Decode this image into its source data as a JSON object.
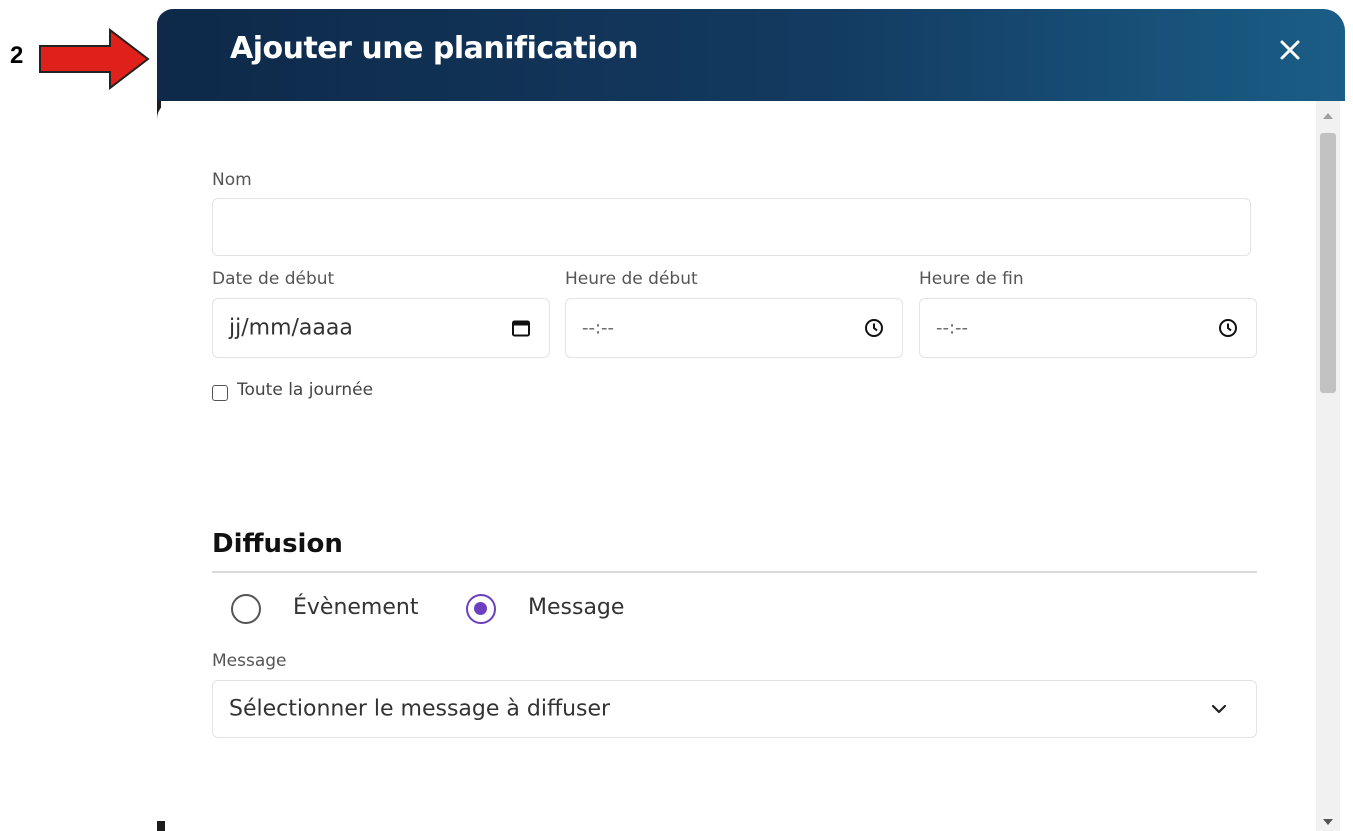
{
  "annotation": {
    "step_number": "2",
    "arrow_color": "#e0211b"
  },
  "dialog": {
    "title": "Ajouter une planification",
    "close_icon": "close-icon",
    "header_colors": [
      "#0e2949",
      "#1a5d86"
    ]
  },
  "form": {
    "name": {
      "label": "Nom",
      "value": ""
    },
    "start_date": {
      "label": "Date de début",
      "placeholder": "jj/mm/aaaa",
      "icon": "calendar-icon"
    },
    "start_time": {
      "label": "Heure de début",
      "placeholder": "--:--",
      "icon": "clock-icon"
    },
    "end_time": {
      "label": "Heure de fin",
      "placeholder": "--:--",
      "icon": "clock-icon"
    },
    "all_day": {
      "label": "Toute la journée",
      "checked": false
    }
  },
  "diffusion": {
    "title": "Diffusion",
    "options": [
      {
        "label": "Évènement",
        "selected": false
      },
      {
        "label": "Message",
        "selected": true
      }
    ],
    "accent_color": "#6b3fbf",
    "message": {
      "label": "Message",
      "placeholder": "Sélectionner le message à diffuser",
      "icon": "chevron-down-icon"
    }
  }
}
